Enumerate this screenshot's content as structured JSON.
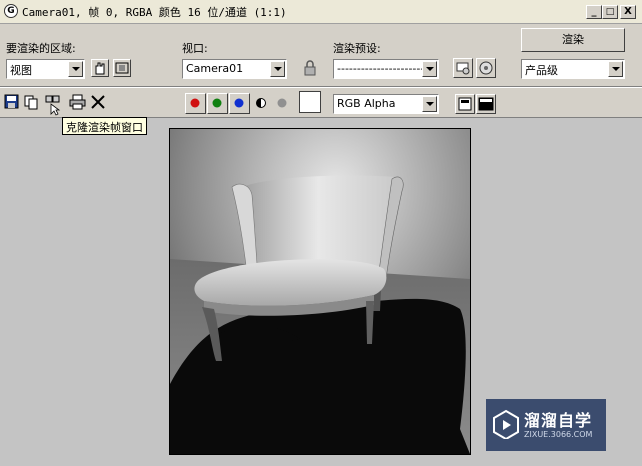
{
  "window": {
    "title": "Camera01, 帧 0, RGBA 颜色 16 位/通道 (1:1)",
    "app_icon_glyph": "G",
    "buttons": {
      "minimize": "_",
      "maximize": "□",
      "close": "X"
    }
  },
  "area_to_render": {
    "label": "要渲染的区域:",
    "value": "视图"
  },
  "viewport": {
    "label": "视口:",
    "value": "Camera01"
  },
  "render_preset": {
    "label": "渲染预设:",
    "value": "-----------------------"
  },
  "render_button": {
    "label": "渲染"
  },
  "production": {
    "value": "产品级"
  },
  "toolbar": {
    "channel_select": "RGB Alpha",
    "tooltip": "克隆渲染帧窗口",
    "colors": {
      "red": "#d01010",
      "green": "#108010",
      "blue": "#1030d0"
    }
  },
  "watermark": {
    "title": "溜溜自学",
    "subtitle": "ZIXUE.3066.COM"
  }
}
